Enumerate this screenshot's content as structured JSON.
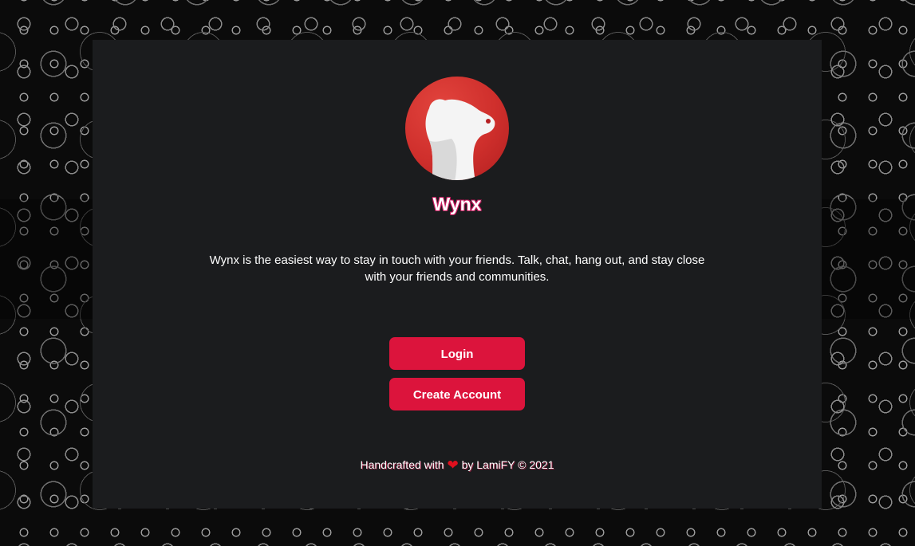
{
  "app": {
    "name": "Wynx",
    "description": "Wynx is the easiest way to stay in touch with your friends. Talk, chat, hang out, and stay close with your friends and communities.",
    "logo_icon": "bear-head-icon"
  },
  "actions": {
    "login_label": "Login",
    "create_account_label": "Create Account"
  },
  "footer": {
    "prefix": "Handcrafted with",
    "heart_icon": "heart-icon",
    "suffix": "by LamiFY © 2021"
  },
  "colors": {
    "accent": "#dc143c",
    "card_bg": "#1b1c1e",
    "logo_red": "#d6332f"
  }
}
